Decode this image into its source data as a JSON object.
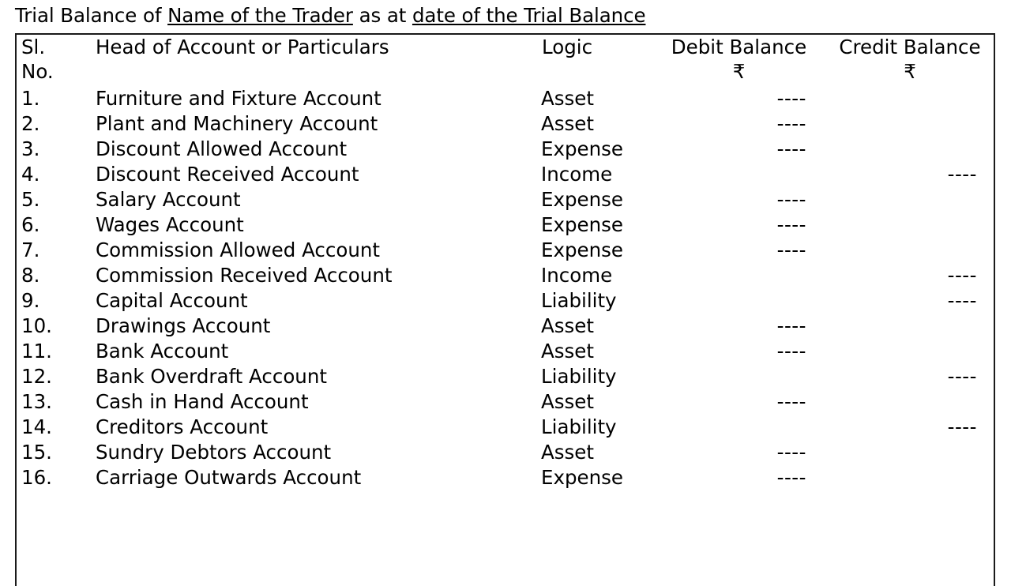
{
  "title": {
    "prefix": "Trial Balance of ",
    "underlined_1": "Name of the Trader",
    "middle": " as at ",
    "underlined_2": "date of the Trial Balance"
  },
  "table": {
    "columns": [
      {
        "key": "sl",
        "label_line1": "Sl.",
        "label_line2": "No.",
        "align": "left"
      },
      {
        "key": "head",
        "label_line1": "Head of Account or Particulars",
        "label_line2": "",
        "align": "left"
      },
      {
        "key": "logic",
        "label_line1": "Logic",
        "label_line2": "",
        "align": "left"
      },
      {
        "key": "debit",
        "label_line1": "Debit Balance",
        "label_line2": "₹",
        "align": "center"
      },
      {
        "key": "credit",
        "label_line1": "Credit Balance",
        "label_line2": "₹",
        "align": "center"
      }
    ],
    "dash": "----",
    "rows": [
      {
        "sl": "1.",
        "head": "Furniture and Fixture Account",
        "logic": "Asset",
        "debit": "----",
        "credit": ""
      },
      {
        "sl": "2.",
        "head": "Plant and Machinery Account",
        "logic": "Asset",
        "debit": "----",
        "credit": ""
      },
      {
        "sl": "3.",
        "head": "Discount Allowed Account",
        "logic": "Expense",
        "debit": "----",
        "credit": ""
      },
      {
        "sl": "4.",
        "head": "Discount Received Account",
        "logic": "Income",
        "debit": "",
        "credit": "----"
      },
      {
        "sl": "5.",
        "head": "Salary Account",
        "logic": "Expense",
        "debit": "----",
        "credit": ""
      },
      {
        "sl": "6.",
        "head": "Wages Account",
        "logic": "Expense",
        "debit": "----",
        "credit": ""
      },
      {
        "sl": "7.",
        "head": "Commission Allowed Account",
        "logic": "Expense",
        "debit": "----",
        "credit": ""
      },
      {
        "sl": "8.",
        "head": "Commission Received Account",
        "logic": "Income",
        "debit": "",
        "credit": "----"
      },
      {
        "sl": "9.",
        "head": "Capital Account",
        "logic": "Liability",
        "debit": "",
        "credit": "----"
      },
      {
        "sl": "10.",
        "head": "Drawings Account",
        "logic": "Asset",
        "debit": "----",
        "credit": ""
      },
      {
        "sl": "11.",
        "head": "Bank Account",
        "logic": "Asset",
        "debit": "----",
        "credit": ""
      },
      {
        "sl": "12.",
        "head": "Bank Overdraft Account",
        "logic": "Liability",
        "debit": "",
        "credit": "----"
      },
      {
        "sl": "13.",
        "head": "Cash in Hand Account",
        "logic": "Asset",
        "debit": "----",
        "credit": ""
      },
      {
        "sl": "14.",
        "head": "Creditors Account",
        "logic": "Liability",
        "debit": "",
        "credit": "----"
      },
      {
        "sl": "15.",
        "head": "Sundry Debtors Account",
        "logic": "Asset",
        "debit": "----",
        "credit": ""
      },
      {
        "sl": "16.",
        "head": "Carriage Outwards Account",
        "logic": "Expense",
        "debit": "----",
        "credit": ""
      }
    ]
  }
}
